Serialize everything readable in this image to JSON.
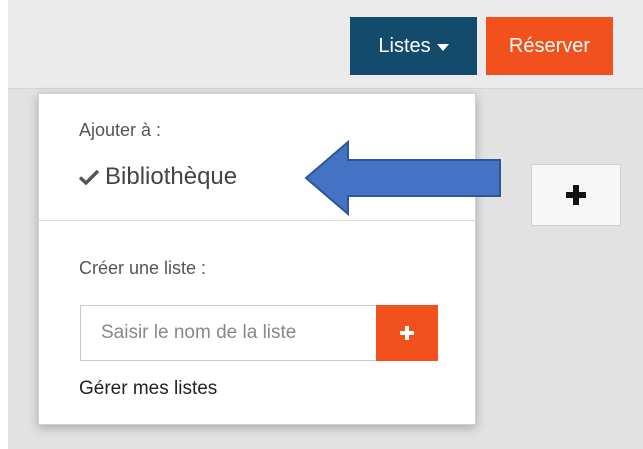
{
  "header": {
    "lists_button_label": "Listes",
    "reserve_button_label": "Réserver"
  },
  "dropdown": {
    "add_to_label": "Ajouter à :",
    "library_item_label": "Bibliothèque",
    "library_item_checked": true,
    "create_list_label": "Créer une liste :",
    "list_name_placeholder": "Saisir le nom de la liste",
    "list_name_value": "",
    "manage_lists_label": "Gérer mes listes"
  },
  "icons": {
    "caret": "caret-down-icon",
    "check": "check-icon",
    "plus": "plus-icon",
    "annotation": "arrow-left-icon"
  },
  "colors": {
    "lists_button": "#124b6b",
    "reserve_button": "#f2501c",
    "add_button": "#f2501c",
    "annotation_arrow_fill": "#4472c4",
    "annotation_arrow_stroke": "#2f5597"
  }
}
